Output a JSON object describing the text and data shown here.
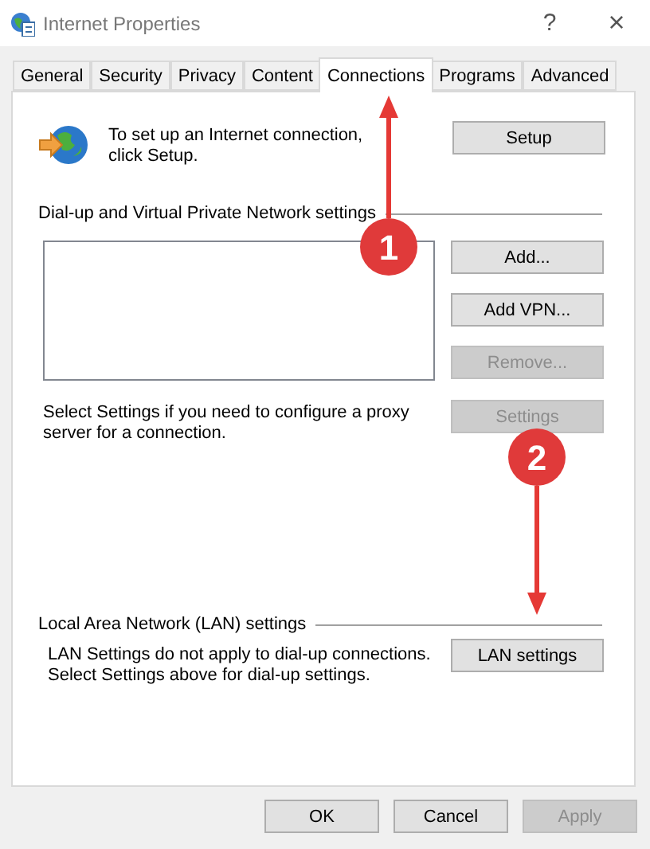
{
  "window": {
    "title": "Internet Properties",
    "help": "?",
    "close": "×"
  },
  "tabs": [
    {
      "label": "General",
      "selected": false
    },
    {
      "label": "Security",
      "selected": false
    },
    {
      "label": "Privacy",
      "selected": false
    },
    {
      "label": "Content",
      "selected": false
    },
    {
      "label": "Connections",
      "selected": true
    },
    {
      "label": "Programs",
      "selected": false
    },
    {
      "label": "Advanced",
      "selected": false
    }
  ],
  "setup": {
    "text": "To set up an Internet connection, click Setup.",
    "button": "Setup"
  },
  "dialup": {
    "heading": "Dial-up and Virtual Private Network settings",
    "buttons": [
      {
        "label": "Add...",
        "disabled": false
      },
      {
        "label": "Add VPN...",
        "disabled": false
      },
      {
        "label": "Remove...",
        "disabled": true
      }
    ],
    "proxy_text": "Select Settings if you need to configure a proxy server for a connection.",
    "settings_button": {
      "label": "Settings",
      "disabled": true
    }
  },
  "lan": {
    "heading": "Local Area Network (LAN) settings",
    "text": "LAN Settings do not apply to dial-up connections. Select Settings above for dial-up settings.",
    "button": "LAN settings"
  },
  "footer_buttons": [
    {
      "label": "OK",
      "disabled": false
    },
    {
      "label": "Cancel",
      "disabled": false
    },
    {
      "label": "Apply",
      "disabled": true
    }
  ],
  "annotations": [
    {
      "number": "1"
    },
    {
      "number": "2"
    }
  ]
}
